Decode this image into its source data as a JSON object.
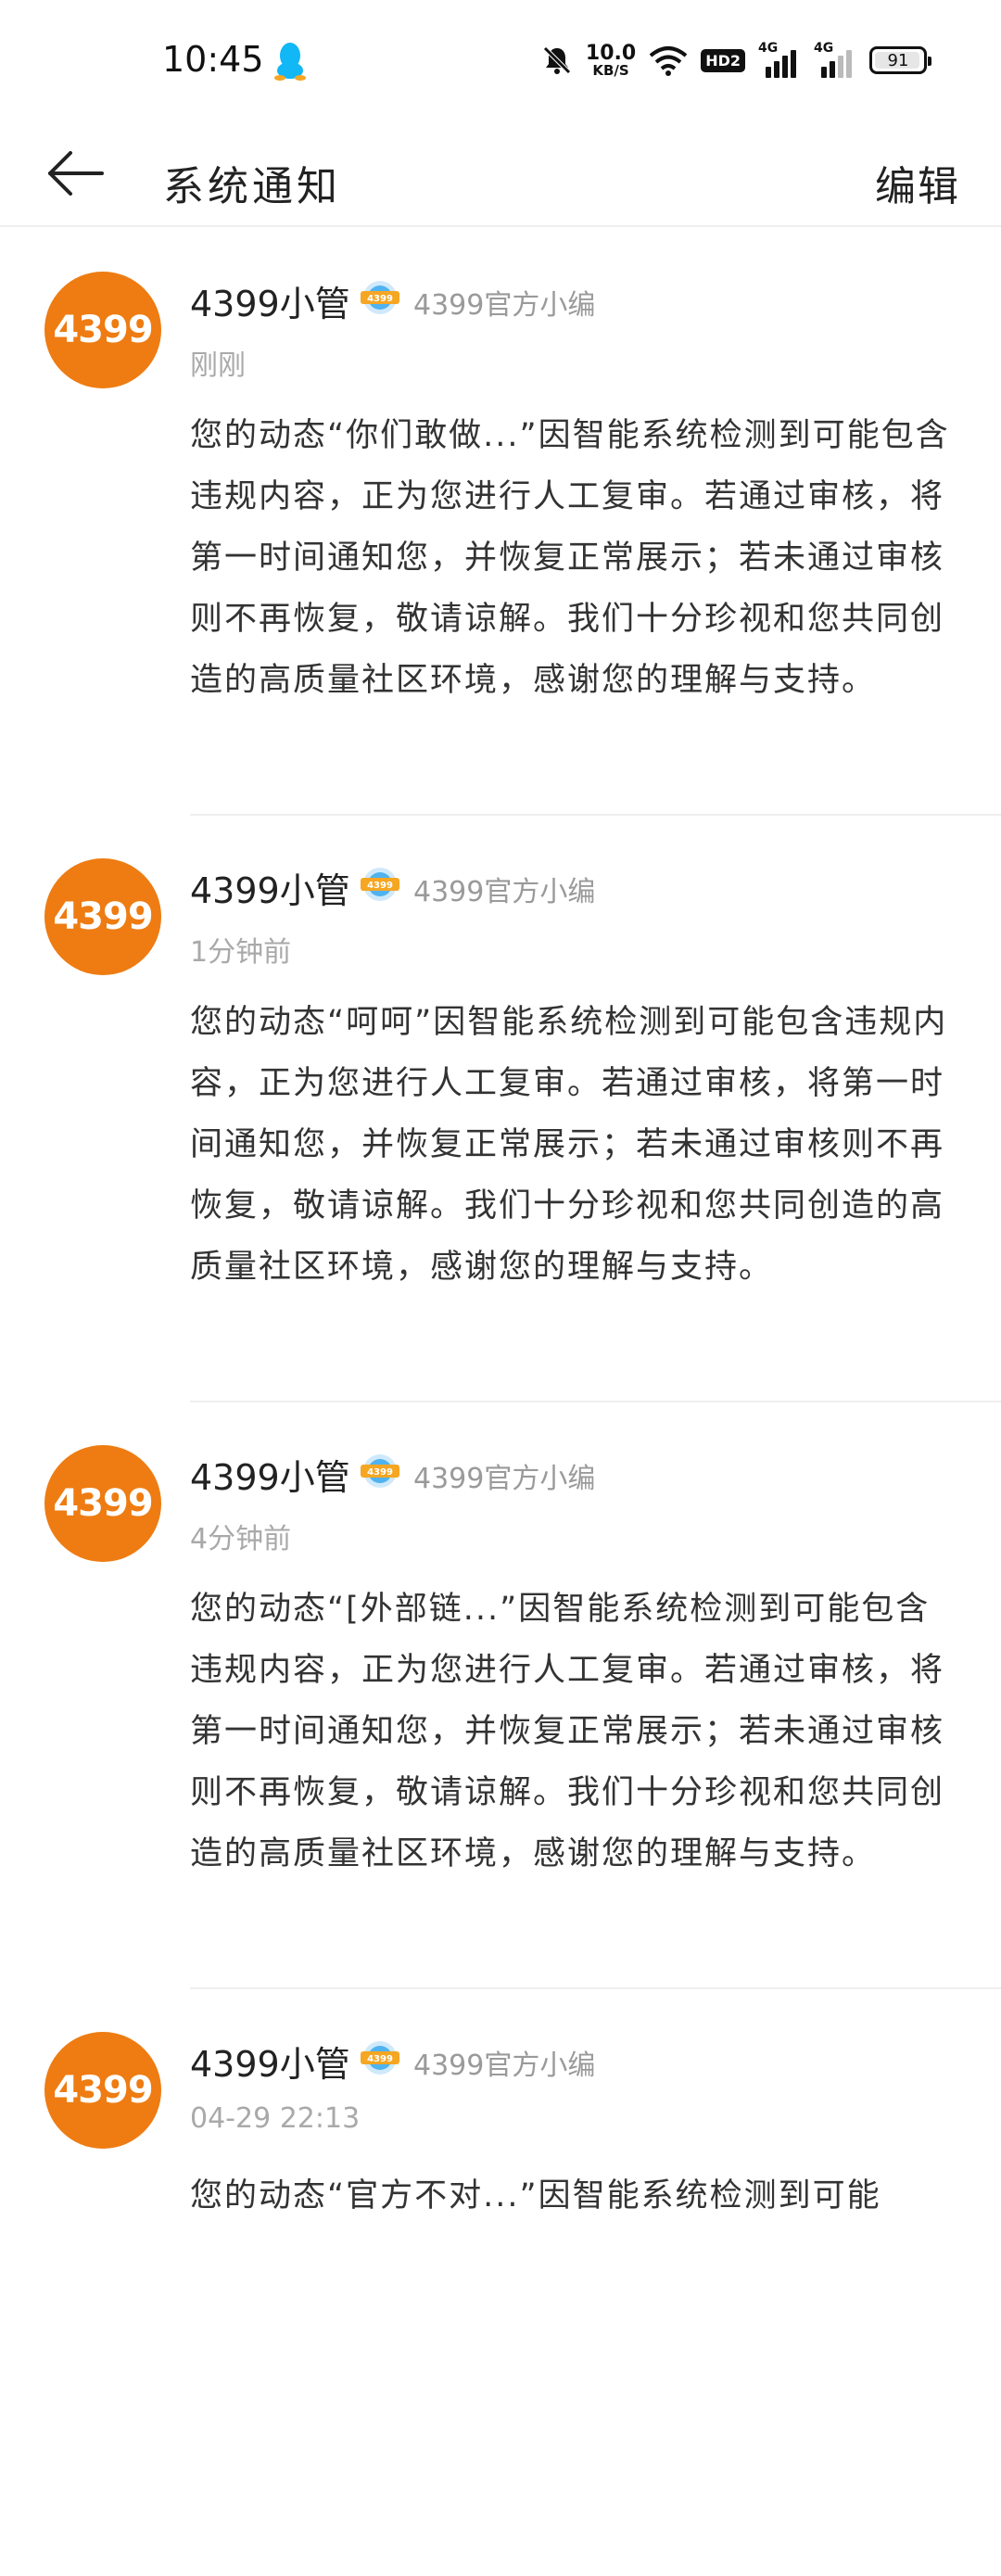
{
  "status_bar": {
    "time": "10:45",
    "speed_value": "10.0",
    "speed_unit": "KB/S",
    "hd_label": "HD2",
    "signal1_label": "4G",
    "signal2_label": "4G",
    "battery": "91"
  },
  "header": {
    "title": "系统通知",
    "edit_label": "编辑"
  },
  "notifications": [
    {
      "avatar_text": "4399",
      "sender": "4399小管",
      "badge_text": "4399",
      "role": "4399官方小编",
      "time": "刚刚",
      "content": "您的动态“你们敢做...”因智能系统检测到可能包含违规内容，正为您进行人工复审。若通过审核，将第一时间通知您，并恢复正常展示；若未通过审核则不再恢复，敬请谅解。我们十分珍视和您共同创造的高质量社区环境，感谢您的理解与支持。"
    },
    {
      "avatar_text": "4399",
      "sender": "4399小管",
      "badge_text": "4399",
      "role": "4399官方小编",
      "time": "1分钟前",
      "content": "您的动态“呵呵”因智能系统检测到可能包含违规内容，正为您进行人工复审。若通过审核，将第一时间通知您，并恢复正常展示；若未通过审核则不再恢复，敬请谅解。我们十分珍视和您共同创造的高质量社区环境，感谢您的理解与支持。"
    },
    {
      "avatar_text": "4399",
      "sender": "4399小管",
      "badge_text": "4399",
      "role": "4399官方小编",
      "time": "4分钟前",
      "content": "您的动态“[外部链...”因智能系统检测到可能包含违规内容，正为您进行人工复审。若通过审核，将第一时间通知您，并恢复正常展示；若未通过审核则不再恢复，敬请谅解。我们十分珍视和您共同创造的高质量社区环境，感谢您的理解与支持。"
    },
    {
      "avatar_text": "4399",
      "sender": "4399小管",
      "badge_text": "4399",
      "role": "4399官方小编",
      "time": "04-29 22:13",
      "content": "您的动态“官方不对...”因智能系统检测到可能"
    }
  ],
  "colors": {
    "avatar_bg": "#ee7c12",
    "secondary_text": "#9a9a9a",
    "divider": "#efefef"
  }
}
